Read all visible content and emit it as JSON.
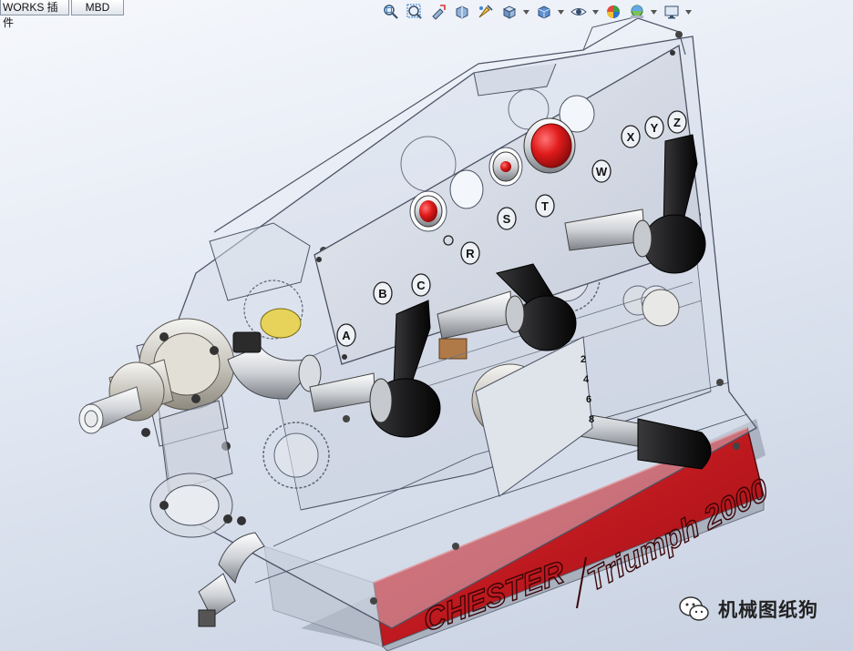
{
  "tabs": {
    "first_label": "WORKS 插件",
    "second_label": "MBD"
  },
  "heads_up_toolbar": {
    "icons": [
      "zoom-to-fit-icon",
      "zoom-to-area-icon",
      "previous-view-icon",
      "section-view-icon",
      "dynamic-annotation-icon",
      "view-orientation-icon",
      "display-style-icon",
      "hide-show-items-icon",
      "edit-appearance-icon",
      "apply-scene-icon",
      "view-settings-icon"
    ]
  },
  "model": {
    "brand_text": "CHESTER",
    "model_text": "Triumph 2000",
    "panel_letters": [
      "A",
      "B",
      "C",
      "R",
      "S",
      "T",
      "W",
      "X",
      "Y",
      "Z"
    ],
    "scale_numbers": [
      "2",
      "4",
      "6",
      "8"
    ],
    "colors": {
      "base_red": "#c8161d",
      "button_red": "#e01b1b",
      "panel": "#d2d8e4",
      "handle_black": "#1c1c1e"
    }
  },
  "watermark": {
    "text": "机械图纸狗"
  }
}
